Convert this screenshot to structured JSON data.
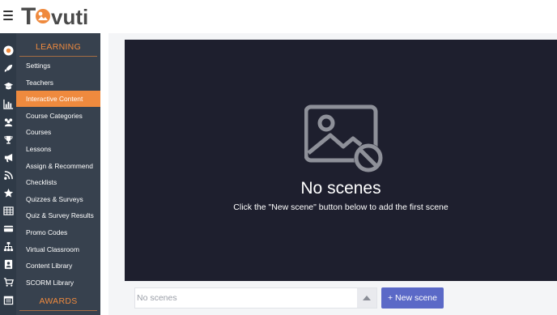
{
  "app": {
    "logo_text": "Tovuti"
  },
  "icon_rail": [
    "avatar-icon",
    "rocket-icon",
    "graduation-cap-icon",
    "bar-chart-icon",
    "users-icon",
    "trophy-icon",
    "megaphone-icon",
    "rss-icon",
    "star-icon",
    "table-icon",
    "credit-card-icon",
    "sitemap-icon",
    "contact-card-icon",
    "cart-icon",
    "calendar-icon"
  ],
  "sidebar": {
    "section_learning": "LEARNING",
    "items": [
      {
        "label": "Settings",
        "active": false
      },
      {
        "label": "Teachers",
        "active": false
      },
      {
        "label": "Interactive Content",
        "active": true
      },
      {
        "label": "Course Categories",
        "active": false
      },
      {
        "label": "Courses",
        "active": false
      },
      {
        "label": "Lessons",
        "active": false
      },
      {
        "label": "Assign & Recommend",
        "active": false
      },
      {
        "label": "Checklists",
        "active": false
      },
      {
        "label": "Quizzes & Surveys",
        "active": false
      },
      {
        "label": "Quiz & Survey Results",
        "active": false
      },
      {
        "label": "Promo Codes",
        "active": false
      },
      {
        "label": "Virtual Classroom",
        "active": false
      },
      {
        "label": "Content Library",
        "active": false
      },
      {
        "label": "SCORM Library",
        "active": false
      }
    ],
    "section_awards": "AWARDS"
  },
  "stage": {
    "title": "No scenes",
    "subtitle": "Click the \"New scene\" button below to add the first scene"
  },
  "scene_selector": {
    "value": "No scenes"
  },
  "new_scene_button": {
    "label": "+ New scene"
  },
  "colors": {
    "accent": "#ef8a3e",
    "sidebar_bg": "#37414e",
    "stage_bg": "#1e1f2e",
    "button": "#5b69c7"
  }
}
